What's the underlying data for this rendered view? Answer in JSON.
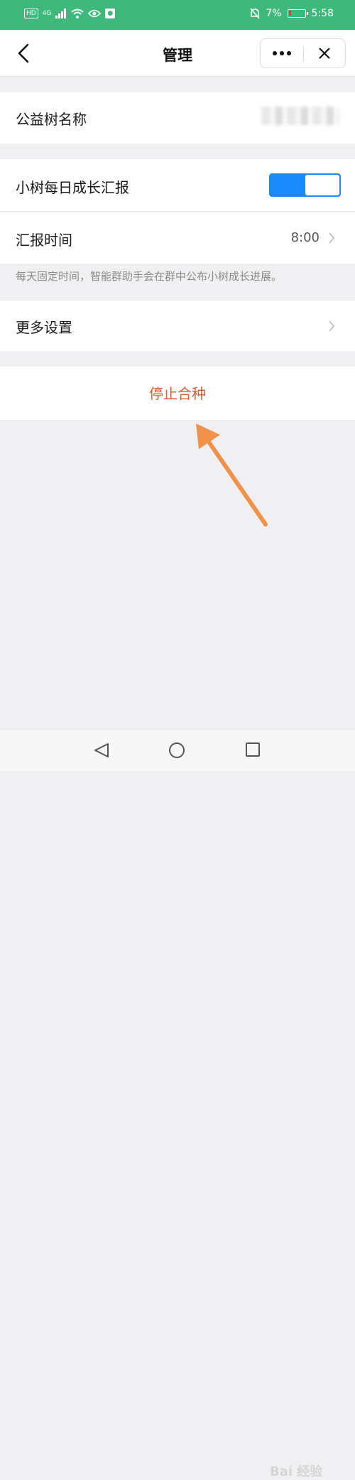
{
  "status_bar": {
    "hd": "HD",
    "network": "4G",
    "battery_percent": "7%",
    "time": "5:58",
    "battery_level": 0.07
  },
  "nav": {
    "title": "管理"
  },
  "rows": {
    "tree_name_label": "公益树名称",
    "daily_report_label": "小树每日成长汇报",
    "daily_report_on": true,
    "report_time_label": "汇报时间",
    "report_time_value": "8:00",
    "hint": "每天固定时间，智能群助手会在群中公布小树成长进展。",
    "more_settings_label": "更多设置",
    "stop_label": "停止合种"
  },
  "watermark": "Bai 经验",
  "colors": {
    "status_bar": "#3fb87c",
    "switch_on": "#1b8cff",
    "danger_text": "#d0603a",
    "annotation_arrow": "#f0924a"
  },
  "icons": [
    "back-chevron-icon",
    "more-dots-icon",
    "close-icon",
    "chevron-right-icon",
    "nav-back-icon",
    "nav-home-icon",
    "nav-recent-icon"
  ]
}
